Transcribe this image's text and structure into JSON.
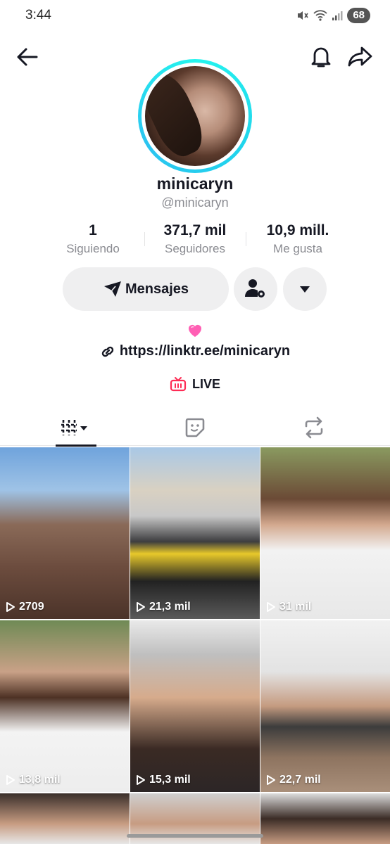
{
  "status_bar": {
    "time": "3:44",
    "battery": "68"
  },
  "profile": {
    "display_name": "minicaryn",
    "handle": "@minicaryn",
    "stats": [
      {
        "value": "1",
        "label": "Siguiendo"
      },
      {
        "value": "371,7 mil",
        "label": "Seguidores"
      },
      {
        "value": "10,9 mill.",
        "label": "Me gusta"
      }
    ],
    "message_button": "Mensajes",
    "link": "https://linktr.ee/minicaryn",
    "live_label": "LIVE"
  },
  "colors": {
    "accent_ring": "#25f4ee",
    "live_icon": "#fe2c55",
    "heart": "#ff5fb4"
  },
  "videos": [
    {
      "views": "2709"
    },
    {
      "views": "21,3 mil"
    },
    {
      "views": "31 mil"
    },
    {
      "views": "13,8 mil"
    },
    {
      "views": "15,3 mil"
    },
    {
      "views": "22,7 mil"
    },
    {
      "views": ""
    },
    {
      "views": ""
    },
    {
      "views": ""
    }
  ]
}
